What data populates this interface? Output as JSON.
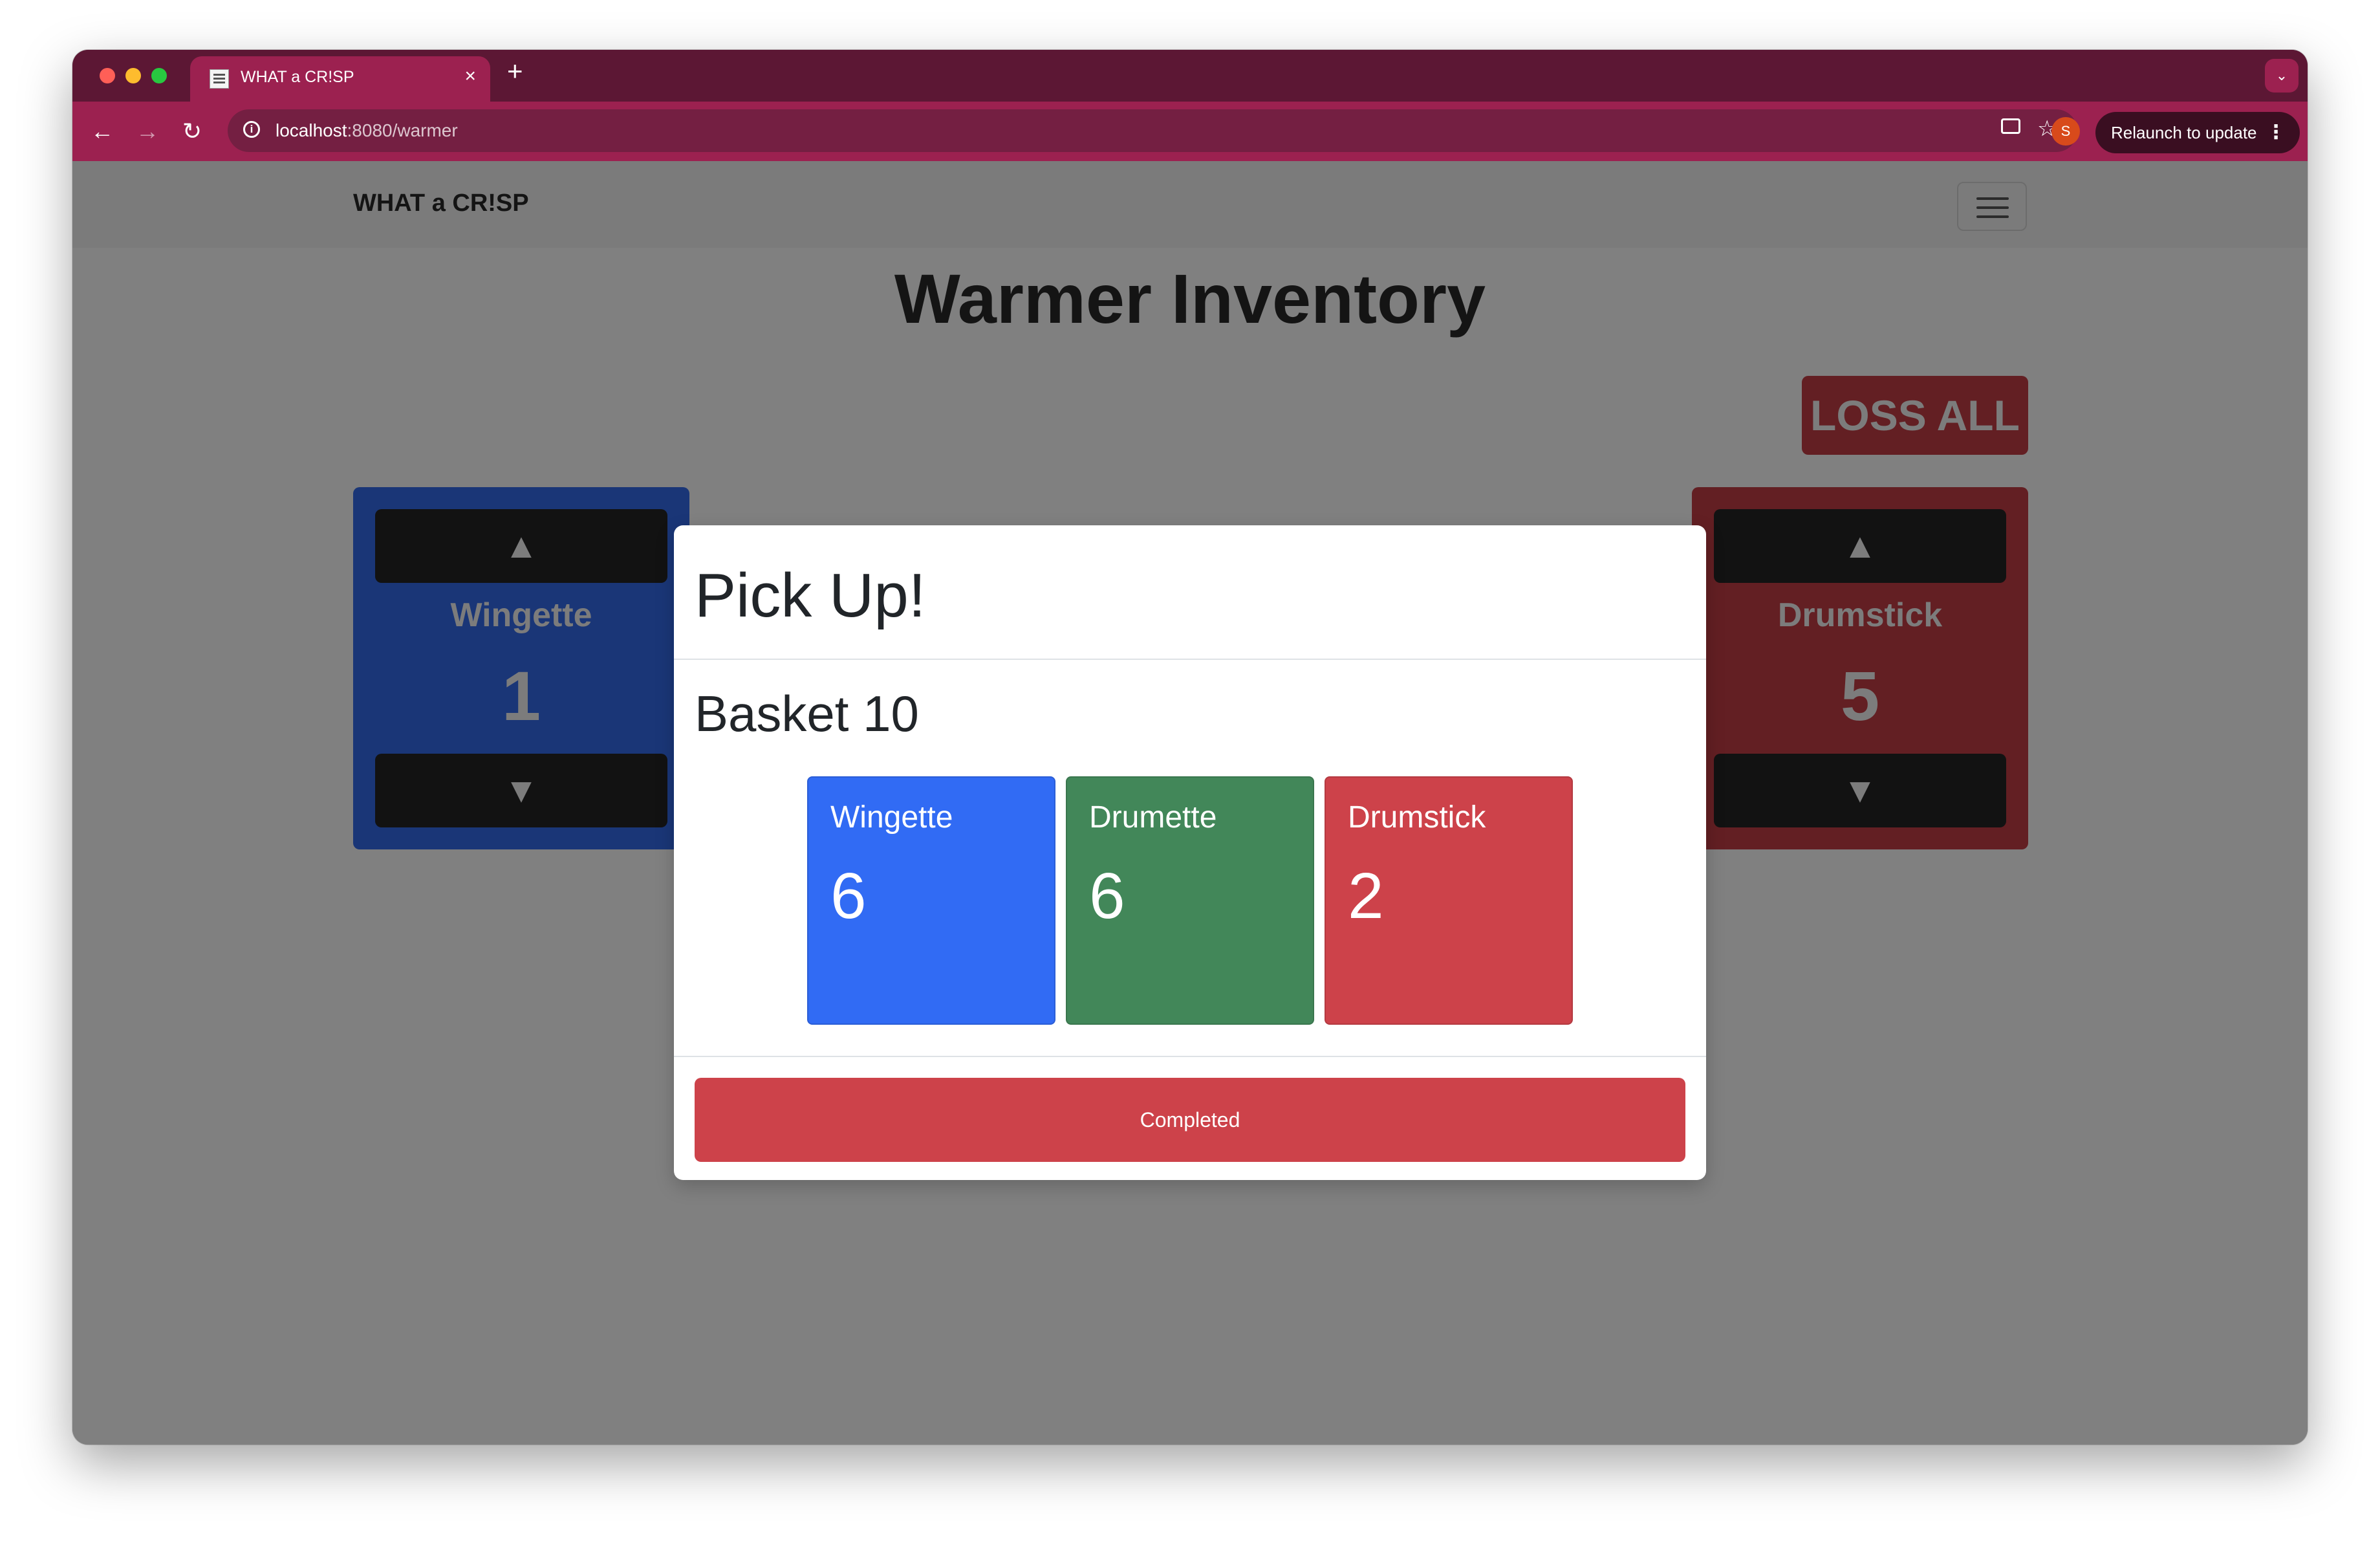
{
  "browser": {
    "tab_title": "WHAT a CR!SP",
    "new_tab_symbol": "+",
    "close_symbol": "×",
    "tab_search_symbol": "⌄",
    "url_host": "localhost",
    "url_path": ":8080/warmer",
    "profile_initial": "S",
    "relaunch_label": "Relaunch to update"
  },
  "navbar": {
    "brand": "WHAT a CR!SP"
  },
  "page": {
    "title": "Warmer Inventory",
    "loss_all_label": "LOSS ALL"
  },
  "inventory": [
    {
      "name": "Wingette",
      "count": "1",
      "color": "#1a3677"
    },
    {
      "name": "Drumstick",
      "count": "5",
      "color": "#631f23"
    }
  ],
  "modal": {
    "title": "Pick Up!",
    "basket": "Basket 10",
    "items": [
      {
        "name": "Wingette",
        "count": "6",
        "color": "#316bf4"
      },
      {
        "name": "Drumette",
        "count": "6",
        "color": "#428759"
      },
      {
        "name": "Drumstick",
        "count": "2",
        "color": "#cd424a"
      }
    ],
    "completed_label": "Completed"
  },
  "icons": {
    "up_arrow": "▲",
    "down_arrow": "▼",
    "back": "←",
    "forward": "→",
    "reload": "↻",
    "star": "☆",
    "info": "i",
    "menu_dots": "⋮"
  }
}
